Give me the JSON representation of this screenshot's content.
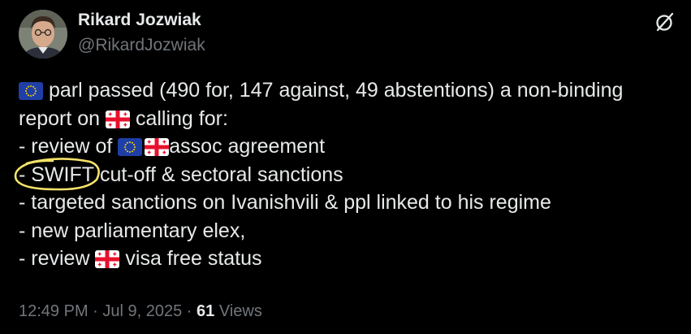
{
  "author": {
    "name": "Rikard Jozwiak",
    "handle": "@RikardJozwiak",
    "avatar_icon": "profile-photo"
  },
  "header_icon": "grok-icon",
  "flags": {
    "eu": "eu-flag-emoji",
    "georgia": "georgia-flag-emoji"
  },
  "tweet": {
    "line1_text": " parl passed (490 for, 147 against, 49 abstentions) a non-binding",
    "line2_a": "report on ",
    "line2_b": " calling for:",
    "line3_a": "- review of ",
    "line3_b": "assoc agreement",
    "line4_swift": "- SWIFT",
    "line4_rest": " cut-off & sectoral sanctions",
    "line5": "- targeted sanctions on Ivanishvili & ppl linked to his regime",
    "line6": "- new parliamentary elex,",
    "line7_a": "- review ",
    "line7_b": " visa free status"
  },
  "meta": {
    "time": "12:49 PM",
    "sep1": " · ",
    "date": "Jul 9, 2025",
    "sep2": " · ",
    "views_count": "61",
    "views_label": " Views"
  },
  "colors": {
    "background": "#000000",
    "text": "#e7e9ea",
    "secondary": "#71767b",
    "highlight_circle": "#f5e36a",
    "eu_blue": "#1f3fa6",
    "eu_star": "#ffd700",
    "georgia_red": "#e8112d"
  }
}
